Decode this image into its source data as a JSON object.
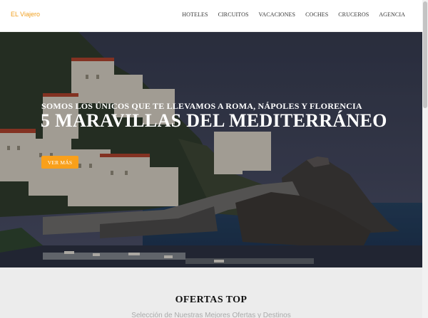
{
  "header": {
    "brand": "EL Viajero",
    "nav": [
      "HOTELES",
      "CIRCUITOS",
      "VACACIONES",
      "COCHES",
      "CRUCEROS",
      "AGENCIA"
    ]
  },
  "hero": {
    "subtitle": "SOMOS LOS ÚNICOS QUE TE LLEVAMOS A ROMA, NÁPOLES Y FLORENCIA",
    "title": "5 MARAVILLAS DEL MEDITERRÁNEO",
    "button": "VER MÁS"
  },
  "offers": {
    "title": "OFERTAS TOP",
    "subtitle": "Selección de Nuestras Mejores Ofertas y Destinos"
  },
  "colors": {
    "accent": "#f9a01b",
    "brand": "#f0a020",
    "section_bg": "#ececec"
  }
}
